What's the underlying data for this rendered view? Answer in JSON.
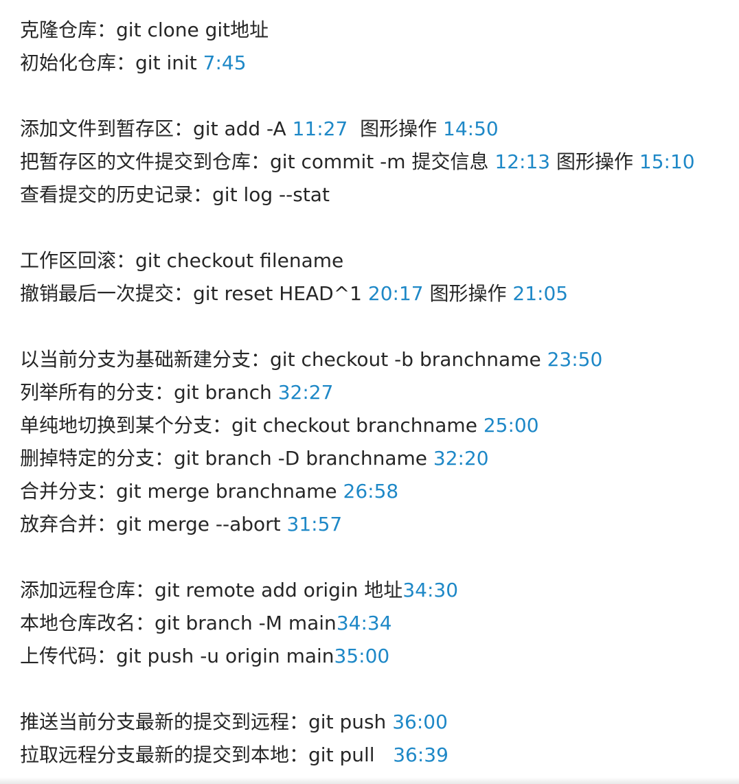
{
  "note": {
    "groups": [
      {
        "lines": [
          {
            "label": "克隆仓库：",
            "command": "git clone git地址",
            "after": "",
            "ts1": "",
            "mid": "",
            "ts2": ""
          },
          {
            "label": "初始化仓库：",
            "command": "git init ",
            "after": "",
            "ts1": "7:45",
            "mid": "",
            "ts2": ""
          }
        ]
      },
      {
        "lines": [
          {
            "label": "添加文件到暂存区：",
            "command": "git add -A ",
            "after": "",
            "ts1": "11:27",
            "mid": "  图形操作 ",
            "ts2": "14:50"
          },
          {
            "label": "把暂存区的文件提交到仓库：",
            "command": "git commit -m 提交信息 ",
            "after": "",
            "ts1": "12:13",
            "mid": " 图形操作 ",
            "ts2": "15:10"
          },
          {
            "label": "查看提交的历史记录：",
            "command": "git log --stat",
            "after": "",
            "ts1": "",
            "mid": "",
            "ts2": ""
          }
        ]
      },
      {
        "lines": [
          {
            "label": "工作区回滚：",
            "command": "git checkout filename",
            "after": "",
            "ts1": "",
            "mid": "",
            "ts2": ""
          },
          {
            "label": "撤销最后一次提交：",
            "command": "git reset HEAD^1 ",
            "after": "",
            "ts1": "20:17",
            "mid": " 图形操作 ",
            "ts2": "21:05"
          }
        ]
      },
      {
        "lines": [
          {
            "label": "以当前分支为基础新建分支：",
            "command": "git checkout -b branchname ",
            "after": "",
            "ts1": "23:50",
            "mid": "",
            "ts2": ""
          },
          {
            "label": "列举所有的分支：",
            "command": "git branch ",
            "after": "",
            "ts1": "32:27",
            "mid": "",
            "ts2": ""
          },
          {
            "label": "单纯地切换到某个分支：",
            "command": "git checkout branchname ",
            "after": "",
            "ts1": "25:00",
            "mid": "",
            "ts2": ""
          },
          {
            "label": "删掉特定的分支：",
            "command": "git branch -D branchname ",
            "after": "",
            "ts1": "32:20",
            "mid": "",
            "ts2": ""
          },
          {
            "label": "合并分支：",
            "command": "git merge branchname ",
            "after": "",
            "ts1": "26:58",
            "mid": "",
            "ts2": ""
          },
          {
            "label": "放弃合并：",
            "command": "git merge --abort ",
            "after": "",
            "ts1": "31:57",
            "mid": "",
            "ts2": ""
          }
        ]
      },
      {
        "lines": [
          {
            "label": "添加远程仓库：",
            "command": "git remote add origin 地址",
            "after": "",
            "ts1": "34:30",
            "mid": "",
            "ts2": ""
          },
          {
            "label": "本地仓库改名：",
            "command": "git branch -M main",
            "after": "",
            "ts1": "34:34",
            "mid": "",
            "ts2": ""
          },
          {
            "label": "上传代码：",
            "command": "git push -u origin main",
            "after": "",
            "ts1": "35:00",
            "mid": "",
            "ts2": ""
          }
        ]
      },
      {
        "lines": [
          {
            "label": "推送当前分支最新的提交到远程：",
            "command": "git push ",
            "after": "",
            "ts1": "36:00",
            "mid": "",
            "ts2": ""
          },
          {
            "label": "拉取远程分支最新的提交到本地：",
            "command": "git pull   ",
            "after": "",
            "ts1": "36:39",
            "mid": "",
            "ts2": ""
          }
        ]
      }
    ]
  },
  "colors": {
    "text": "#262626",
    "timestamp": "#1e88c7",
    "background": "#ffffff"
  }
}
